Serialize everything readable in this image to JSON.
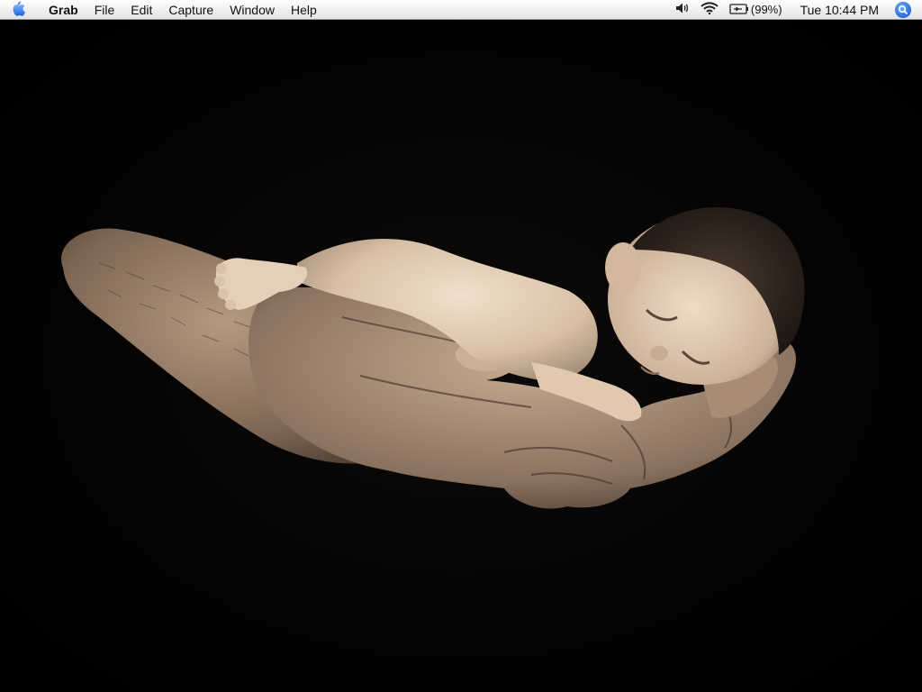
{
  "menubar": {
    "apple_icon": "apple-logo-icon",
    "app_name": "Grab",
    "menus": [
      "File",
      "Edit",
      "Capture",
      "Window",
      "Help"
    ],
    "status": {
      "volume_icon": "speaker-icon",
      "wifi_icon": "wifi-icon",
      "battery_icon": "battery-charging-icon",
      "battery_percent": "(99%)",
      "clock": "Tue 10:44 PM",
      "spotlight_icon": "spotlight-search-icon"
    }
  },
  "desktop": {
    "wallpaper": "sepia photo of a newborn baby sleeping in an adult's cupped hands on a black background",
    "colors": {
      "background": "#000000",
      "skin_light": "#e6d3be",
      "skin_mid": "#b59a80",
      "skin_dark": "#5d4a3c",
      "spotlight_blue": "#2f73e0"
    }
  }
}
